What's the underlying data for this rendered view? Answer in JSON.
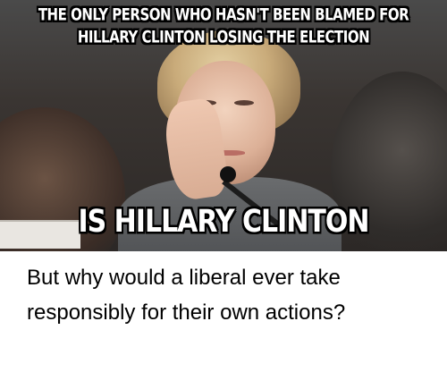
{
  "meme": {
    "top_line_1": "THE ONLY PERSON WHO HASN'T BEEN BLAMED FOR",
    "top_line_2": "HILLARY CLINTON LOSING THE ELECTION",
    "bottom_text": "IS HILLARY CLINTON"
  },
  "caption": {
    "text": "But why would a liberal ever take responsibly for their own actions?"
  },
  "colors": {
    "caption_text": "#000000",
    "meme_text": "#ffffff",
    "meme_outline": "#000000"
  }
}
